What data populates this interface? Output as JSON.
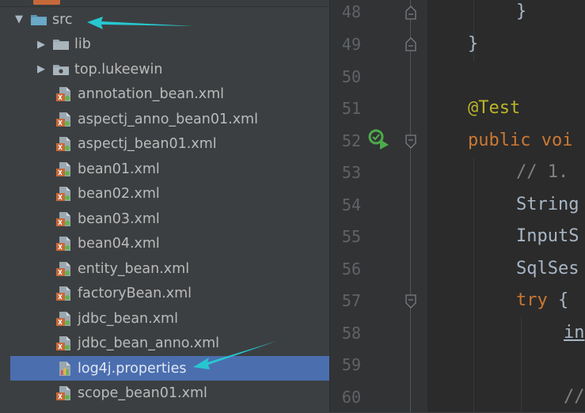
{
  "tree": {
    "items": [
      {
        "label": "src",
        "kind": "folder-open",
        "arrow": "▼"
      },
      {
        "label": "lib",
        "kind": "folder",
        "arrow": "▶"
      },
      {
        "label": "top.lukeewin",
        "kind": "package",
        "arrow": "▶"
      },
      {
        "label": "annotation_bean.xml",
        "kind": "xml"
      },
      {
        "label": "aspectj_anno_bean01.xml",
        "kind": "xml"
      },
      {
        "label": "aspectj_bean01.xml",
        "kind": "xml"
      },
      {
        "label": "bean01.xml",
        "kind": "xml"
      },
      {
        "label": "bean02.xml",
        "kind": "xml"
      },
      {
        "label": "bean03.xml",
        "kind": "xml"
      },
      {
        "label": "bean04.xml",
        "kind": "xml"
      },
      {
        "label": "entity_bean.xml",
        "kind": "xml"
      },
      {
        "label": "factoryBean.xml",
        "kind": "xml"
      },
      {
        "label": "jdbc_bean.xml",
        "kind": "xml"
      },
      {
        "label": "jdbc_bean_anno.xml",
        "kind": "xml"
      },
      {
        "label": "log4j.properties",
        "kind": "properties",
        "selected": true
      },
      {
        "label": "scope_bean01.xml",
        "kind": "xml"
      }
    ]
  },
  "editor": {
    "line_numbers": [
      "48",
      "49",
      "50",
      "51",
      "52",
      "53",
      "54",
      "55",
      "56",
      "57",
      "58",
      "59",
      "60"
    ],
    "lines": {
      "l48": "}",
      "l49": "}",
      "l51_ann": "@Test",
      "l52_kw": "public voi",
      "l53_cm": "// 1.",
      "l54_id": "String",
      "l55_id": "InputS",
      "l56_id": "SqlSes",
      "l57_kw": "try",
      "l57_punc": " {",
      "l58_id": "in",
      "l60_cm": "//"
    }
  },
  "colors": {
    "tree_bg": "#3c3f41",
    "selection": "#4b6eaf",
    "editor_bg": "#2b2b2b",
    "annotation_arrow": "#27c7cf"
  }
}
